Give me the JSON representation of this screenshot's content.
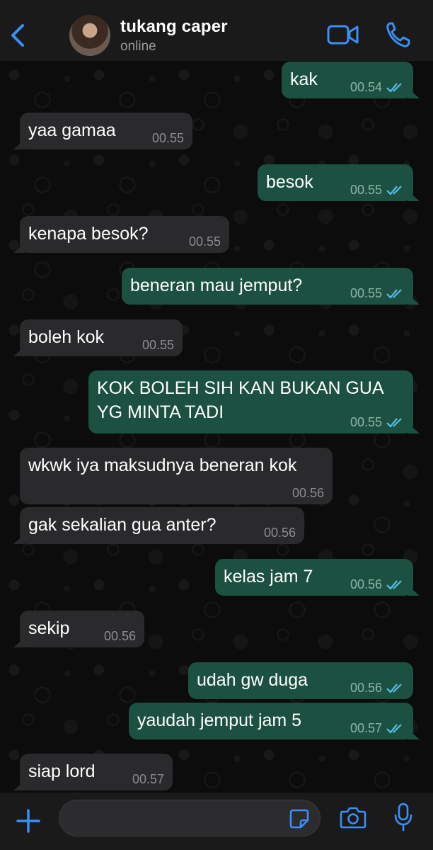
{
  "header": {
    "contact_name": "tukang caper",
    "status": "online"
  },
  "colors": {
    "accent": "#3b8ff6",
    "outgoing_bubble": "#1c5141",
    "incoming_bubble": "#2a2a2c",
    "read_ticks": "#53bdeb"
  },
  "messages": [
    {
      "dir": "out",
      "text": "kak",
      "time": "00.54"
    },
    {
      "dir": "in",
      "text": "yaa gamaa",
      "time": "00.55"
    },
    {
      "dir": "out",
      "text": "besok",
      "time": "00.55"
    },
    {
      "dir": "in",
      "text": "kenapa besok?",
      "time": "00.55"
    },
    {
      "dir": "out",
      "text": "beneran mau jemput?",
      "time": "00.55"
    },
    {
      "dir": "in",
      "text": "boleh kok",
      "time": "00.55"
    },
    {
      "dir": "out",
      "text": "KOK BOLEH SIH KAN BUKAN GUA\nYG MINTA TADI",
      "time": "00.55"
    },
    {
      "dir": "in",
      "text": "wkwk iya maksudnya beneran kok",
      "time": "00.56"
    },
    {
      "dir": "in",
      "text": "gak sekalian gua anter?",
      "time": "00.56"
    },
    {
      "dir": "out",
      "text": "kelas jam 7",
      "time": "00.56"
    },
    {
      "dir": "in",
      "text": "sekip",
      "time": "00.56"
    },
    {
      "dir": "out",
      "text": "udah gw duga",
      "time": "00.56"
    },
    {
      "dir": "out",
      "text": "yaudah jemput jam 5",
      "time": "00.57"
    },
    {
      "dir": "in",
      "text": "siap lord",
      "time": "00.57"
    }
  ],
  "composer": {
    "placeholder": ""
  }
}
